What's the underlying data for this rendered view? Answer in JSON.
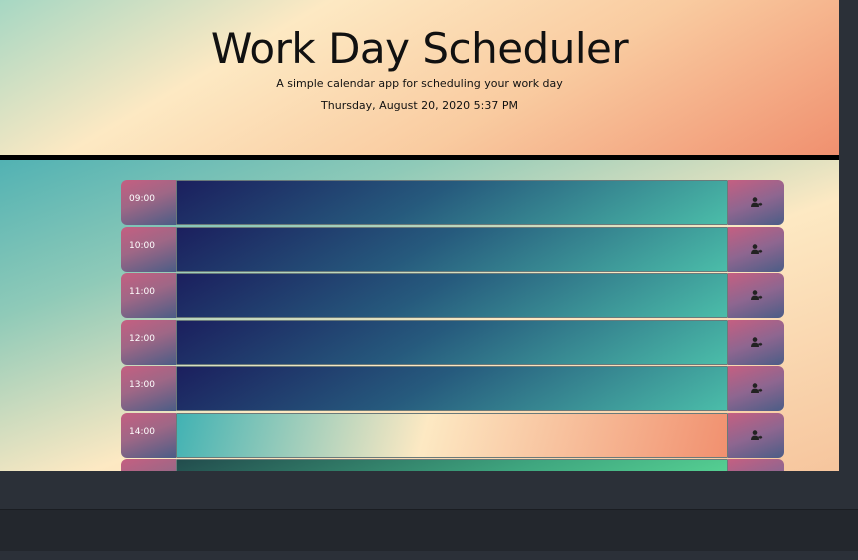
{
  "header": {
    "title": "Work Day Scheduler",
    "lead": "A simple calendar app for scheduling your work day",
    "current_day": "Thursday, August 20, 2020 5:37 PM"
  },
  "rows": [
    {
      "hour": "09:00",
      "status": "past"
    },
    {
      "hour": "10:00",
      "status": "past"
    },
    {
      "hour": "11:00",
      "status": "past"
    },
    {
      "hour": "12:00",
      "status": "past"
    },
    {
      "hour": "13:00",
      "status": "past"
    },
    {
      "hour": "14:00",
      "status": "present"
    },
    {
      "hour": "",
      "status": "future"
    }
  ],
  "icons": {
    "save": "user-save-icon"
  },
  "colors": {
    "past": "#1b1f5e",
    "present": "#f1906f",
    "future": "#5ee09a",
    "hour_block": "#9e6786"
  }
}
